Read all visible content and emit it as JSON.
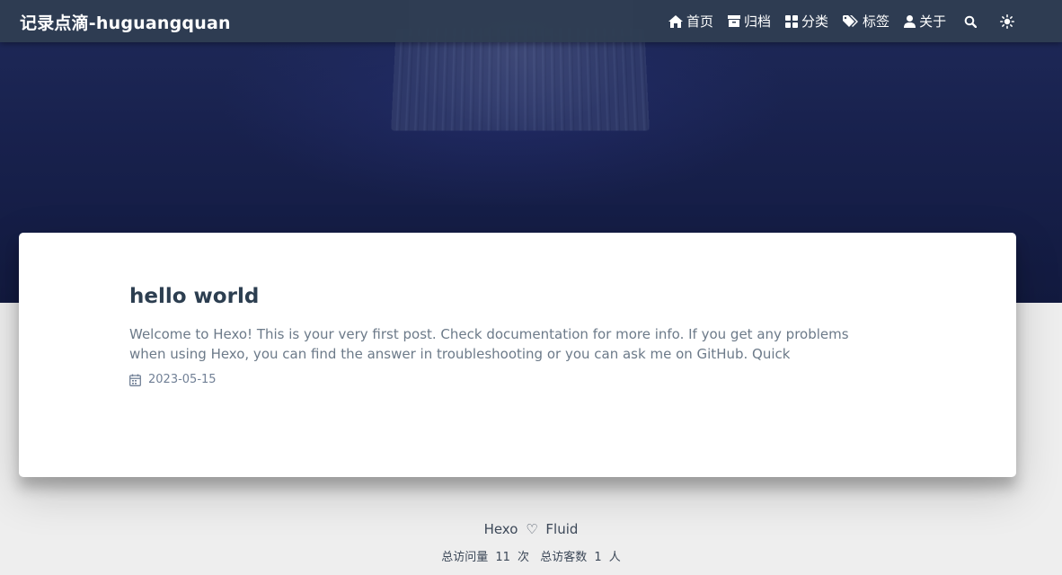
{
  "navbar": {
    "brand": "记录点滴-huguangquan",
    "items": [
      {
        "label": "首页",
        "icon": "home-icon"
      },
      {
        "label": "归档",
        "icon": "archive-icon"
      },
      {
        "label": "分类",
        "icon": "categories-icon"
      },
      {
        "label": "标签",
        "icon": "tags-icon"
      },
      {
        "label": "关于",
        "icon": "user-icon"
      }
    ],
    "search_icon": "search-icon",
    "theme_icon": "sun-icon"
  },
  "post": {
    "title": "hello world",
    "excerpt": "Welcome to Hexo! This is your very first post. Check documentation for more info. If you get any problems when using Hexo, you can find the answer in troubleshooting or you can ask me on GitHub. Quick",
    "date": "2023-05-15",
    "date_icon": "calendar-icon"
  },
  "footer": {
    "left": "Hexo",
    "heart": "♡",
    "right": "Fluid",
    "visits_label": "总访问量",
    "visits_count": "11",
    "visits_unit": "次",
    "visitors_label": "总访客数",
    "visitors_count": "1",
    "visitors_unit": "人"
  },
  "colors": {
    "navbar_bg": "#2f3d52",
    "title": "#2c3e50",
    "excerpt": "#6c7a89",
    "page_bg": "#eeeeee"
  }
}
